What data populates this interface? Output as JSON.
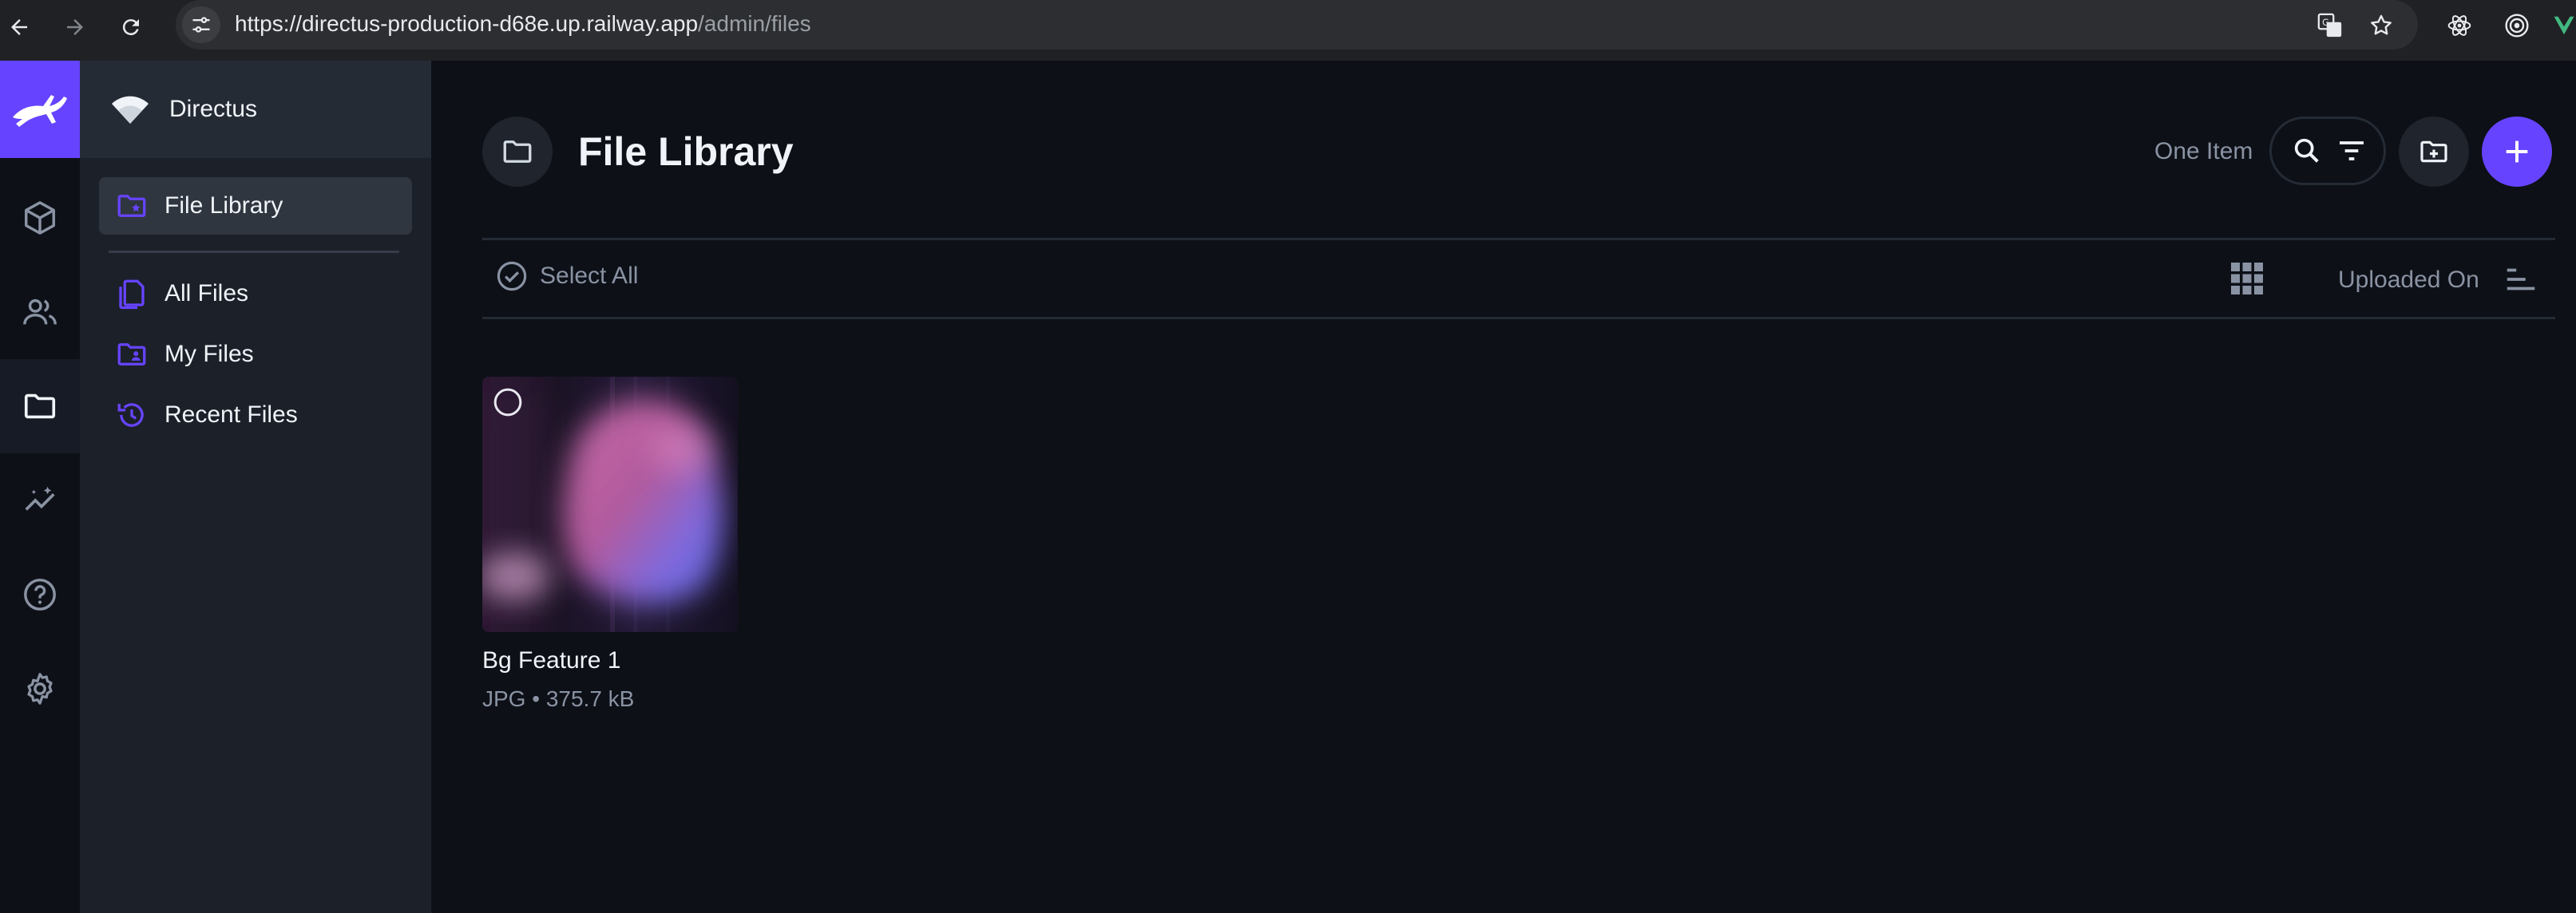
{
  "browser": {
    "url_host": "https://directus-production-d68e.up.railway.app",
    "url_path": "/admin/files"
  },
  "project": {
    "name": "Directus"
  },
  "module_bar": {
    "items": [
      {
        "icon": "content-cube-icon"
      },
      {
        "icon": "users-icon"
      },
      {
        "icon": "folder-icon",
        "active": true
      },
      {
        "icon": "insights-icon"
      },
      {
        "icon": "help-icon"
      },
      {
        "icon": "settings-gear-icon"
      }
    ]
  },
  "nav": {
    "items": [
      {
        "label": "File Library",
        "icon": "folder-special-icon",
        "active": true
      },
      {
        "label": "All Files",
        "icon": "files-copy-icon"
      },
      {
        "label": "My Files",
        "icon": "folder-shared-icon"
      },
      {
        "label": "Recent Files",
        "icon": "history-icon"
      }
    ]
  },
  "header": {
    "title": "File Library",
    "count": "One Item"
  },
  "toolbar": {
    "select_all": "Select All",
    "sort_label": "Uploaded On"
  },
  "files": [
    {
      "title": "Bg Feature 1",
      "meta": "JPG • 375.7 kB"
    }
  ],
  "colors": {
    "accent": "#6644ff",
    "background": "#0d1017",
    "sidebar": "#1c2029"
  }
}
